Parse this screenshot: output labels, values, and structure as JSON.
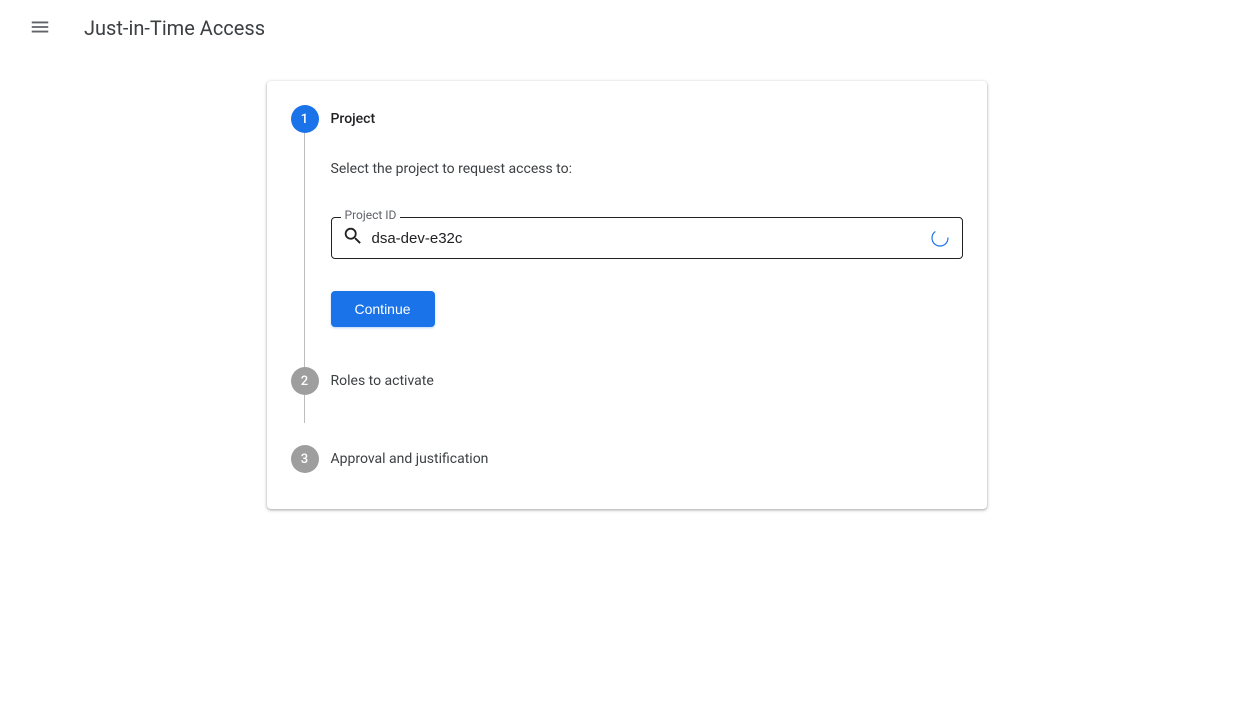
{
  "app": {
    "title": "Just-in-Time Access"
  },
  "stepper": {
    "step1": {
      "number": "1",
      "title": "Project",
      "description": "Select the project to request access to:",
      "field_label": "Project ID",
      "field_value": "dsa-dev-e32c",
      "continue_label": "Continue"
    },
    "step2": {
      "number": "2",
      "title": "Roles to activate"
    },
    "step3": {
      "number": "3",
      "title": "Approval and justification"
    }
  },
  "colors": {
    "primary": "#1a73e8",
    "inactive": "#9e9e9e"
  }
}
